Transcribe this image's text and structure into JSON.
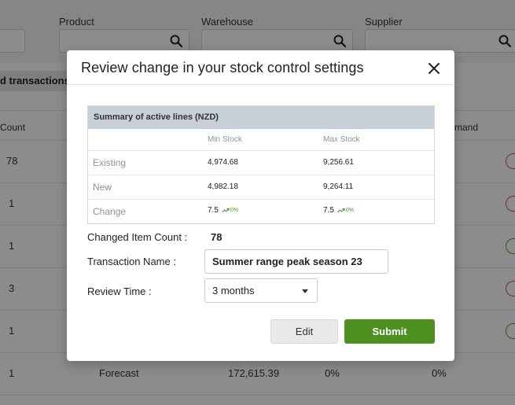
{
  "background": {
    "filters": [
      {
        "label": "Product"
      },
      {
        "label": "Warehouse"
      },
      {
        "label": "Supplier"
      }
    ],
    "toolbar_chip": "d transactions",
    "columns": {
      "count": "Count",
      "demand": "mand"
    },
    "rows": [
      {
        "count": "78"
      },
      {
        "count": "1"
      },
      {
        "count": "1"
      },
      {
        "count": "3"
      },
      {
        "count": "1"
      },
      {
        "count": "1",
        "type": "Forecast",
        "value": "172,615.39",
        "pct1": "0%",
        "pct2": "0%"
      }
    ],
    "status_colors": [
      "#d9534f",
      "#d9534f",
      "#5aa03a",
      "#d9534f",
      "#5aa03a"
    ]
  },
  "modal": {
    "title": "Review change in your stock control settings",
    "summary": {
      "heading": "Summary of active lines (NZD)",
      "col_min": "Min Stock",
      "col_max": "Max Stock",
      "rows": [
        {
          "label": "Existing",
          "min": "4,974.68",
          "max": "9,256.61"
        },
        {
          "label": "New",
          "min": "4,982.18",
          "max": "9,264.11"
        },
        {
          "label": "Change",
          "min": "7.5",
          "max": "7.5",
          "min_pct": "0%",
          "max_pct": "0%"
        }
      ]
    },
    "changed_count_label": "Changed Item Count :",
    "changed_count_value": "78",
    "transaction_label": "Transaction Name :",
    "transaction_value": "Summer range peak season 23",
    "review_label": "Review Time :",
    "review_value": "3 months",
    "edit_label": "Edit",
    "submit_label": "Submit"
  },
  "colors": {
    "accent": "#4e9020",
    "positive": "#3e9b2a"
  }
}
